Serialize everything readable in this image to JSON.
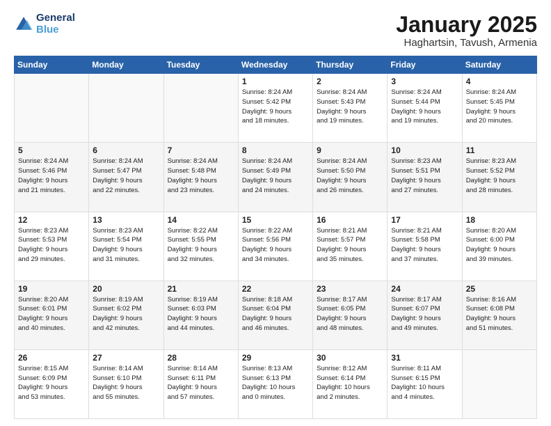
{
  "logo": {
    "line1": "General",
    "line2": "Blue"
  },
  "title": "January 2025",
  "subtitle": "Haghartsin, Tavush, Armenia",
  "weekdays": [
    "Sunday",
    "Monday",
    "Tuesday",
    "Wednesday",
    "Thursday",
    "Friday",
    "Saturday"
  ],
  "weeks": [
    [
      {
        "day": "",
        "detail": ""
      },
      {
        "day": "",
        "detail": ""
      },
      {
        "day": "",
        "detail": ""
      },
      {
        "day": "1",
        "detail": "Sunrise: 8:24 AM\nSunset: 5:42 PM\nDaylight: 9 hours\nand 18 minutes."
      },
      {
        "day": "2",
        "detail": "Sunrise: 8:24 AM\nSunset: 5:43 PM\nDaylight: 9 hours\nand 19 minutes."
      },
      {
        "day": "3",
        "detail": "Sunrise: 8:24 AM\nSunset: 5:44 PM\nDaylight: 9 hours\nand 19 minutes."
      },
      {
        "day": "4",
        "detail": "Sunrise: 8:24 AM\nSunset: 5:45 PM\nDaylight: 9 hours\nand 20 minutes."
      }
    ],
    [
      {
        "day": "5",
        "detail": "Sunrise: 8:24 AM\nSunset: 5:46 PM\nDaylight: 9 hours\nand 21 minutes."
      },
      {
        "day": "6",
        "detail": "Sunrise: 8:24 AM\nSunset: 5:47 PM\nDaylight: 9 hours\nand 22 minutes."
      },
      {
        "day": "7",
        "detail": "Sunrise: 8:24 AM\nSunset: 5:48 PM\nDaylight: 9 hours\nand 23 minutes."
      },
      {
        "day": "8",
        "detail": "Sunrise: 8:24 AM\nSunset: 5:49 PM\nDaylight: 9 hours\nand 24 minutes."
      },
      {
        "day": "9",
        "detail": "Sunrise: 8:24 AM\nSunset: 5:50 PM\nDaylight: 9 hours\nand 26 minutes."
      },
      {
        "day": "10",
        "detail": "Sunrise: 8:23 AM\nSunset: 5:51 PM\nDaylight: 9 hours\nand 27 minutes."
      },
      {
        "day": "11",
        "detail": "Sunrise: 8:23 AM\nSunset: 5:52 PM\nDaylight: 9 hours\nand 28 minutes."
      }
    ],
    [
      {
        "day": "12",
        "detail": "Sunrise: 8:23 AM\nSunset: 5:53 PM\nDaylight: 9 hours\nand 29 minutes."
      },
      {
        "day": "13",
        "detail": "Sunrise: 8:23 AM\nSunset: 5:54 PM\nDaylight: 9 hours\nand 31 minutes."
      },
      {
        "day": "14",
        "detail": "Sunrise: 8:22 AM\nSunset: 5:55 PM\nDaylight: 9 hours\nand 32 minutes."
      },
      {
        "day": "15",
        "detail": "Sunrise: 8:22 AM\nSunset: 5:56 PM\nDaylight: 9 hours\nand 34 minutes."
      },
      {
        "day": "16",
        "detail": "Sunrise: 8:21 AM\nSunset: 5:57 PM\nDaylight: 9 hours\nand 35 minutes."
      },
      {
        "day": "17",
        "detail": "Sunrise: 8:21 AM\nSunset: 5:58 PM\nDaylight: 9 hours\nand 37 minutes."
      },
      {
        "day": "18",
        "detail": "Sunrise: 8:20 AM\nSunset: 6:00 PM\nDaylight: 9 hours\nand 39 minutes."
      }
    ],
    [
      {
        "day": "19",
        "detail": "Sunrise: 8:20 AM\nSunset: 6:01 PM\nDaylight: 9 hours\nand 40 minutes."
      },
      {
        "day": "20",
        "detail": "Sunrise: 8:19 AM\nSunset: 6:02 PM\nDaylight: 9 hours\nand 42 minutes."
      },
      {
        "day": "21",
        "detail": "Sunrise: 8:19 AM\nSunset: 6:03 PM\nDaylight: 9 hours\nand 44 minutes."
      },
      {
        "day": "22",
        "detail": "Sunrise: 8:18 AM\nSunset: 6:04 PM\nDaylight: 9 hours\nand 46 minutes."
      },
      {
        "day": "23",
        "detail": "Sunrise: 8:17 AM\nSunset: 6:05 PM\nDaylight: 9 hours\nand 48 minutes."
      },
      {
        "day": "24",
        "detail": "Sunrise: 8:17 AM\nSunset: 6:07 PM\nDaylight: 9 hours\nand 49 minutes."
      },
      {
        "day": "25",
        "detail": "Sunrise: 8:16 AM\nSunset: 6:08 PM\nDaylight: 9 hours\nand 51 minutes."
      }
    ],
    [
      {
        "day": "26",
        "detail": "Sunrise: 8:15 AM\nSunset: 6:09 PM\nDaylight: 9 hours\nand 53 minutes."
      },
      {
        "day": "27",
        "detail": "Sunrise: 8:14 AM\nSunset: 6:10 PM\nDaylight: 9 hours\nand 55 minutes."
      },
      {
        "day": "28",
        "detail": "Sunrise: 8:14 AM\nSunset: 6:11 PM\nDaylight: 9 hours\nand 57 minutes."
      },
      {
        "day": "29",
        "detail": "Sunrise: 8:13 AM\nSunset: 6:13 PM\nDaylight: 10 hours\nand 0 minutes."
      },
      {
        "day": "30",
        "detail": "Sunrise: 8:12 AM\nSunset: 6:14 PM\nDaylight: 10 hours\nand 2 minutes."
      },
      {
        "day": "31",
        "detail": "Sunrise: 8:11 AM\nSunset: 6:15 PM\nDaylight: 10 hours\nand 4 minutes."
      },
      {
        "day": "",
        "detail": ""
      }
    ]
  ]
}
